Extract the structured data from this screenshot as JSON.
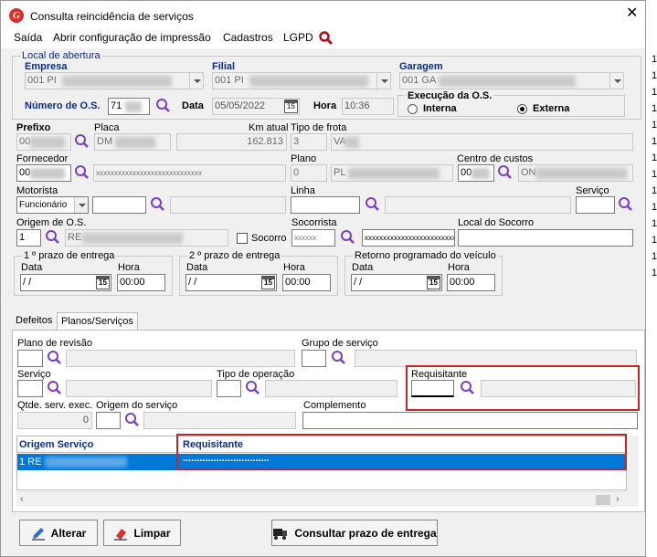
{
  "window": {
    "title": "Consulta reincidência de serviços",
    "close_glyph": "✕",
    "logo_letter": "G"
  },
  "menu": {
    "items": [
      "Saída",
      "Abrir configuração de impressão",
      "Cadastros",
      "LGPD"
    ]
  },
  "local": {
    "group_title": "Local de abertura",
    "empresa_label": "Empresa",
    "empresa_value": "001 PI",
    "filial_label": "Filial",
    "filial_value": "001 PI",
    "garagem_label": "Garagem",
    "garagem_value": "001 GA",
    "numero_os_label": "Número de O.S.",
    "numero_os_value": "71",
    "data_label": "Data",
    "data_value": "05/05/2022",
    "hora_label": "Hora",
    "hora_value": "10:36",
    "execucao_label": "Execução da O.S.",
    "interna_label": "Interna",
    "externa_label": "Externa",
    "selected": "Externa"
  },
  "veiculo": {
    "prefixo_label": "Prefixo",
    "prefixo_value": "00",
    "placa_label": "Placa",
    "placa_value": "DM",
    "km_label": "Km atual",
    "km_value": "162.813",
    "tipo_frota_label": "Tipo de frota",
    "tipo_frota_code": "3",
    "tipo_frota_desc": "VA"
  },
  "fornecedor": {
    "label": "Fornecedor",
    "value": "00",
    "desc": "xxxxxxxxxxxxxxxxxxxxxxxxxxxxx",
    "plano_label": "Plano",
    "plano_value": "0",
    "plano_desc": "PL",
    "centro_label": "Centro de custos",
    "centro_value": "00",
    "centro_desc": "ON"
  },
  "motorista": {
    "label": "Motorista",
    "type_value": "Funcionário",
    "linha_label": "Linha",
    "servico_label": "Serviço"
  },
  "origem": {
    "label": "Origem de O.S.",
    "value": "1",
    "desc": "RE",
    "socorro_label": "Socorro",
    "socorrista_label": "Socorrista",
    "socorrista_value": "xxxxxx",
    "socorrista_desc": "xxxxxxxxxxxxxxxxxxxxxxxxxx",
    "local_socorro_label": "Local do Socorro"
  },
  "prazos": [
    {
      "title": "1 º prazo de entrega",
      "data_label": "Data",
      "data_value": " /  /",
      "hora_label": "Hora",
      "hora_value": "00:00"
    },
    {
      "title": "2 º prazo de entrega",
      "data_label": "Data",
      "data_value": " /  /",
      "hora_label": "Hora",
      "hora_value": "00:00"
    },
    {
      "title": "Retorno programado do veículo",
      "data_label": "Data",
      "data_value": " /  /",
      "hora_label": "Hora",
      "hora_value": "00:00"
    }
  ],
  "tabs": [
    "Defeitos",
    "Planos/Serviços"
  ],
  "planos": {
    "plano_revisao_label": "Plano de revisão",
    "grupo_label": "Grupo de serviço",
    "servico_label": "Serviço",
    "tipo_op_label": "Tipo de operação",
    "requisitante_label": "Requisitante",
    "qtde_label": "Qtde. serv. exec.",
    "qtde_value": "0",
    "origem_servico_label": "Origem do serviço",
    "complemento_label": "Complemento"
  },
  "grid": {
    "headers": [
      "Origem Serviço",
      "Requisitante"
    ],
    "rows": [
      {
        "origem": "1 RE",
        "requisitante": "..............................."
      }
    ]
  },
  "buttons": {
    "alterar": "Alterar",
    "limpar": "Limpar",
    "consultar": "Consultar prazo de entrega"
  },
  "side_rows": [
    "1",
    "1",
    "1",
    "1",
    "1",
    "1",
    "1",
    "1",
    "1",
    "1",
    "1",
    "1",
    "1",
    "1"
  ],
  "colors": {
    "label_blue": "#0b2c8c",
    "highlight": "#c1272d",
    "selection": "#0078d7",
    "search_icon": "#7a3fc0"
  }
}
